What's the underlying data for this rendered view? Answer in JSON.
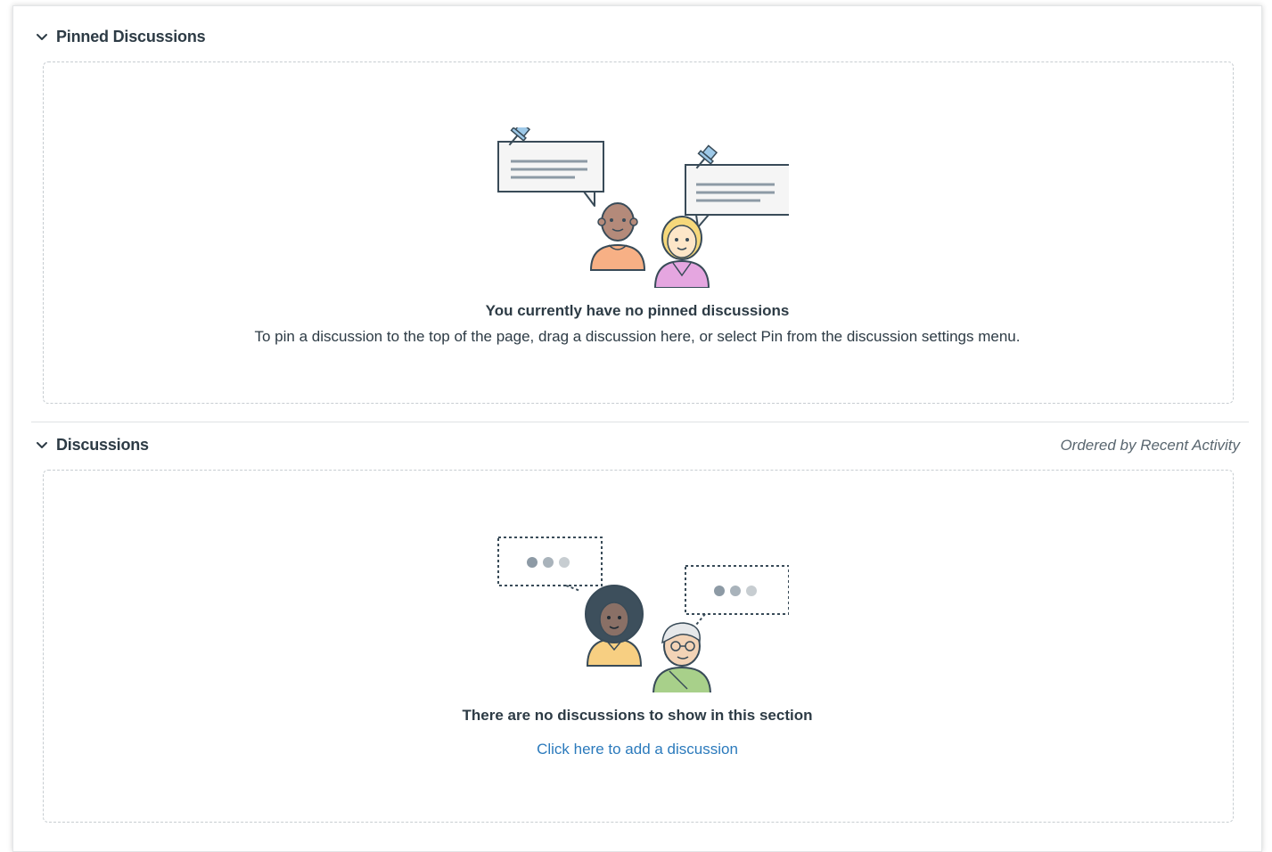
{
  "pinned": {
    "title": "Pinned Discussions",
    "empty_title": "You currently have no pinned discussions",
    "empty_text": "To pin a discussion to the top of the page, drag a discussion here, or select Pin from the discussion settings menu."
  },
  "discussions": {
    "title": "Discussions",
    "order_label": "Ordered by Recent Activity",
    "empty_title": "There are no discussions to show in this section",
    "add_link": "Click here to add a discussion"
  },
  "icons": {
    "collapse": "chevron-down-icon",
    "pinned_art": "pinned-discussions-illustration",
    "empty_art": "empty-discussions-illustration"
  },
  "colors": {
    "link": "#2b7abc",
    "text": "#2d3b45",
    "muted": "#59666f",
    "dash": "#c7cdd1"
  }
}
